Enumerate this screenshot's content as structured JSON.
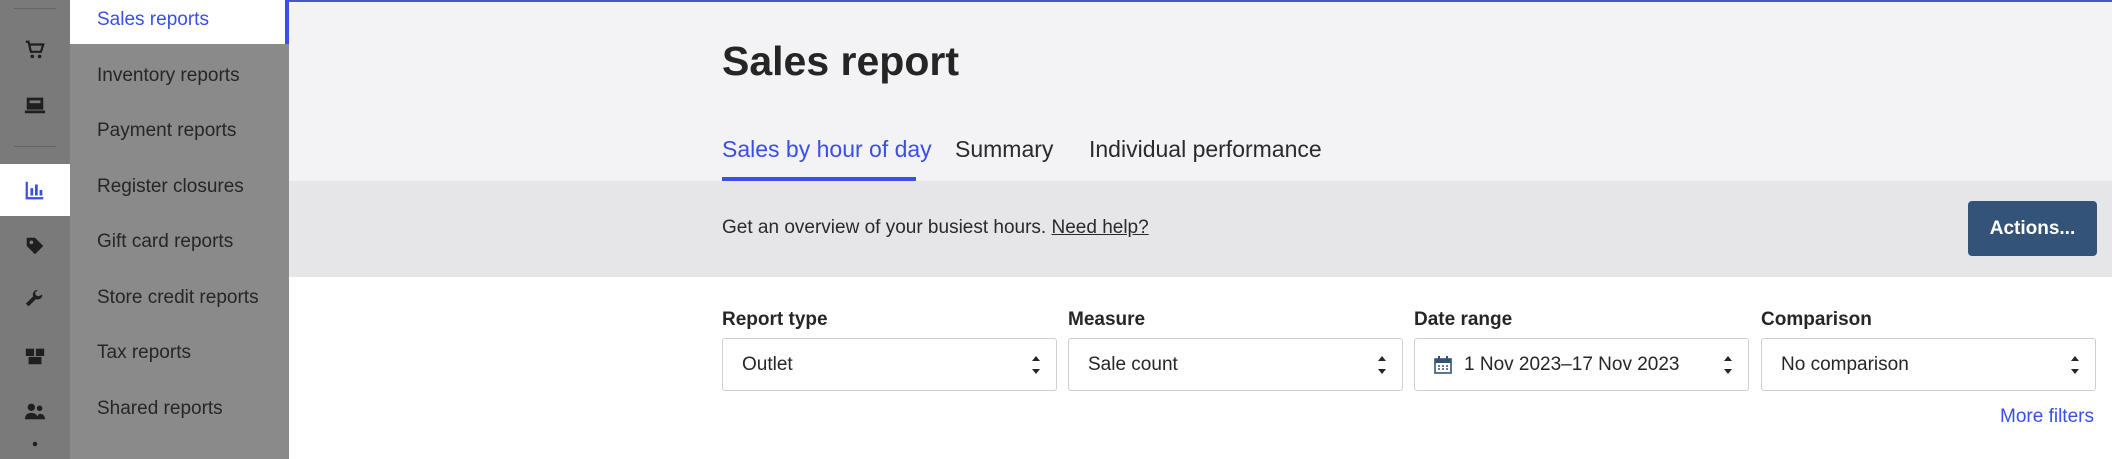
{
  "rail": {
    "icons": [
      "cart-icon",
      "register-icon",
      "reports-icon",
      "tag-icon",
      "wrench-icon",
      "boxes-icon",
      "customers-icon",
      "more-icon"
    ]
  },
  "submenu": {
    "items": [
      {
        "label": "Sales reports",
        "active": true
      },
      {
        "label": "Inventory reports"
      },
      {
        "label": "Payment reports"
      },
      {
        "label": "Register closures"
      },
      {
        "label": "Gift card reports"
      },
      {
        "label": "Store credit reports"
      },
      {
        "label": "Tax reports"
      },
      {
        "label": "Shared reports"
      }
    ]
  },
  "page": {
    "title": "Sales report",
    "tabs": [
      {
        "label": "Sales by hour of day",
        "active": true
      },
      {
        "label": "Summary"
      },
      {
        "label": "Individual performance"
      }
    ],
    "info_text": "Get an overview of your busiest hours.",
    "help_link": "Need help?",
    "actions_label": "Actions..."
  },
  "filters": {
    "report_type": {
      "label": "Report type",
      "value": "Outlet"
    },
    "measure": {
      "label": "Measure",
      "value": "Sale count"
    },
    "date_range": {
      "label": "Date range",
      "value": "1 Nov 2023–17 Nov 2023"
    },
    "comparison": {
      "label": "Comparison",
      "value": "No comparison"
    },
    "more_filters": "More filters"
  },
  "colors": {
    "accent": "#3a4ee8",
    "actions_button": "#345378",
    "sidebar_bg": "#8a8a8a",
    "rail_bg": "#7a7a7a"
  }
}
